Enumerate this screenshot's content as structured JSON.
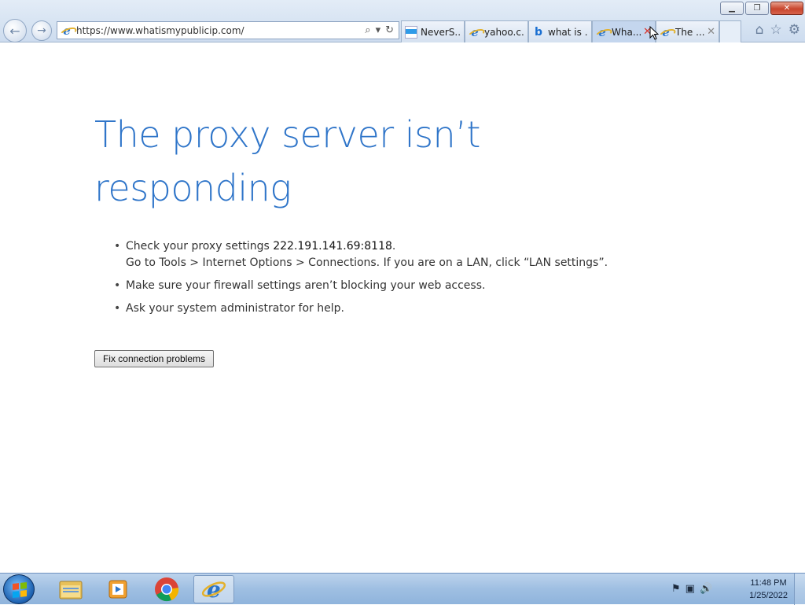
{
  "browser": {
    "address_url": "https://www.whatismypublicip.com/",
    "tabs": [
      {
        "label": "NeverS...",
        "icon": "blue-bar-icon",
        "active": false
      },
      {
        "label": "yahoo.c...",
        "icon": "ie-icon",
        "active": false
      },
      {
        "label": "what is ...",
        "icon": "bing-icon",
        "active": false
      },
      {
        "label": "Wha...",
        "icon": "ie-icon",
        "active": true
      },
      {
        "label": "The ...",
        "icon": "ie-icon",
        "active": false
      }
    ]
  },
  "error_page": {
    "heading_line1": "The proxy server isn’t",
    "heading_line2": "responding",
    "tip1_prefix": "Check your proxy settings ",
    "tip1_proxy": "222.191.141.69:8118",
    "tip1_suffix": ".",
    "tip1_line2": "Go to Tools > Internet Options > Connections. If you are on a LAN, click “LAN settings”.",
    "tip2": "Make sure your firewall settings aren’t blocking your web access.",
    "tip3": "Ask your system administrator for help.",
    "fix_button": "Fix connection problems"
  },
  "taskbar": {
    "time": "11:48 PM",
    "date": "1/25/2022"
  },
  "colors": {
    "heading": "#2f75c9",
    "close_red": "#c8452c"
  }
}
